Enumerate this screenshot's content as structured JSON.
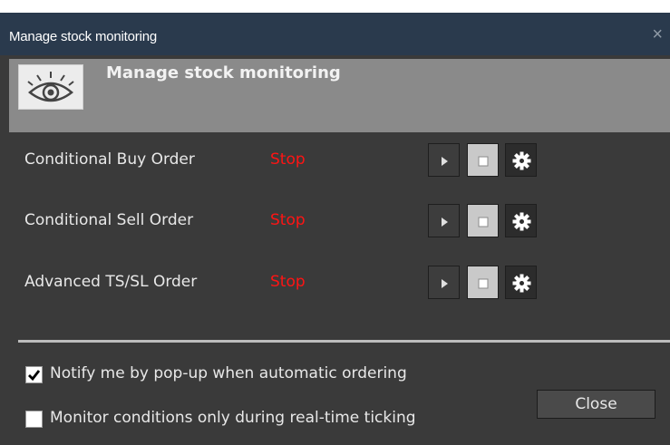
{
  "window": {
    "title": "Manage stock monitoring",
    "close_glyph": "×"
  },
  "header": {
    "title": "Manage stock monitoring",
    "icon": "eye-icon"
  },
  "rows": [
    {
      "label": "Conditional Buy Order",
      "status": "Stop"
    },
    {
      "label": "Conditional Sell Order",
      "status": "Stop"
    },
    {
      "label": "Advanced TS/SL Order",
      "status": "Stop"
    }
  ],
  "options": {
    "notify": {
      "label": "Notify me by pop-up when automatic ordering",
      "checked": true
    },
    "monitor": {
      "label": "Monitor conditions only during real-time ticking",
      "checked": false
    }
  },
  "buttons": {
    "close_label": "Close"
  },
  "colors": {
    "status_stop": "#ff1414",
    "titlebar": "#2a3a4d",
    "panel": "#3a3a3a",
    "header_panel": "#8a8a8a"
  }
}
